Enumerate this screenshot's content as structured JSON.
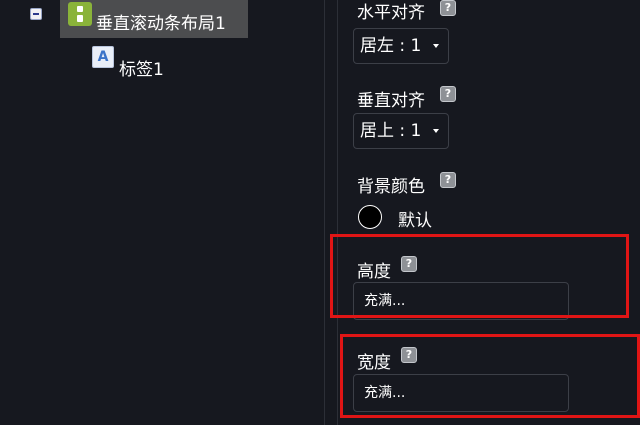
{
  "tree": {
    "node_layout_label": "垂直滚动条布局1",
    "node_layout_icon": "vertical-layout-icon",
    "node_label_label": "标签1",
    "node_label_icon": "label-a-icon",
    "node_label_icon_glyph": "A",
    "collapse_icon": "minus-box-icon"
  },
  "properties": {
    "horizontal_align": {
      "label": "水平对齐",
      "value": "居左 : 1"
    },
    "vertical_align": {
      "label": "垂直对齐",
      "value": "居上 : 1"
    },
    "background_color": {
      "label": "背景颜色",
      "value_text": "默认",
      "swatch_color": "#000000"
    },
    "height": {
      "label": "高度",
      "value": "充满..."
    },
    "width": {
      "label": "宽度",
      "value": "充满..."
    },
    "help_glyph": "?"
  },
  "colors": {
    "background": "#16181f",
    "highlight_border": "#e01515",
    "selected_node": "#4c4d4f",
    "layout_icon": "#8ab33a"
  }
}
